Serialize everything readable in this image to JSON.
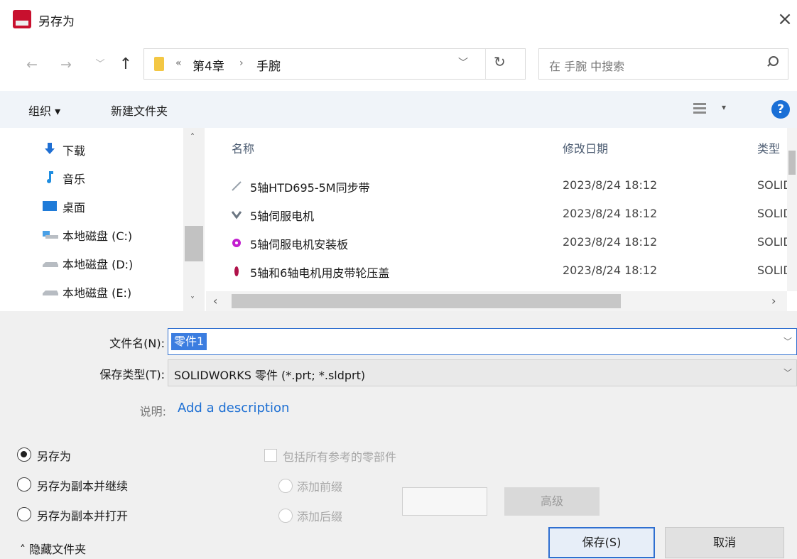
{
  "window": {
    "title": "另存为",
    "close_glyph": "×"
  },
  "nav": {
    "back_glyph": "←",
    "forward_glyph": "→",
    "recent_glyph": "﹀",
    "up_glyph": "↑",
    "breadcrumb": {
      "overflow": "«",
      "parent": "第4章",
      "separator": "›",
      "current": "手腕"
    },
    "dropdown_glyph": "﹀",
    "refresh_glyph": "↻",
    "search_placeholder": "在 手腕 中搜索"
  },
  "toolbar": {
    "organize": "组织 ▾",
    "new_folder": "新建文件夹",
    "view_drop": "▾",
    "help": "?"
  },
  "sidebar": {
    "items": [
      {
        "label": "下载",
        "icon": "download-icon"
      },
      {
        "label": "音乐",
        "icon": "music-icon"
      },
      {
        "label": "桌面",
        "icon": "desktop-icon"
      },
      {
        "label": "本地磁盘 (C:)",
        "icon": "system-drive-icon"
      },
      {
        "label": "本地磁盘 (D:)",
        "icon": "drive-icon"
      },
      {
        "label": "本地磁盘 (E:)",
        "icon": "drive-icon"
      }
    ],
    "scroll_up": "˄",
    "scroll_down": "˅"
  },
  "file_list": {
    "columns": {
      "name": "名称",
      "modified": "修改日期",
      "type": "类型"
    },
    "rows": [
      {
        "name": "5轴HTD695-5M同步带",
        "modified": "2023/8/24 18:12",
        "type": "SOLID",
        "icon_color": "#9aa3ad"
      },
      {
        "name": "5轴伺服电机",
        "modified": "2023/8/24 18:12",
        "type": "SOLID",
        "icon_color": "#6b7682"
      },
      {
        "name": "5轴伺服电机安装板",
        "modified": "2023/8/24 18:12",
        "type": "SOLID",
        "icon_color": "#c21fcf"
      },
      {
        "name": "5轴和6轴电机用皮带轮压盖",
        "modified": "2023/8/24 18:12",
        "type": "SOLID",
        "icon_color": "#b0124a"
      }
    ],
    "scroll_left": "‹",
    "scroll_right": "›"
  },
  "form": {
    "filename_label": "文件名(N):",
    "filename_value": "零件1",
    "filetype_label": "保存类型(T):",
    "filetype_value": "SOLIDWORKS 零件 (*.prt; *.sldprt)",
    "combo_arrow": "﹀",
    "description_label": "说明:",
    "description_link": "Add a description"
  },
  "options": {
    "save_as": "另存为",
    "save_copy_continue": "另存为副本并继续",
    "save_copy_open": "另存为副本并打开",
    "include_refs": "包括所有参考的零部件",
    "add_prefix": "添加前缀",
    "add_suffix": "添加后缀",
    "advanced": "高级"
  },
  "buttons": {
    "save": "保存(S)",
    "cancel": "取消",
    "hide_folders": "˄ 隐藏文件夹"
  }
}
